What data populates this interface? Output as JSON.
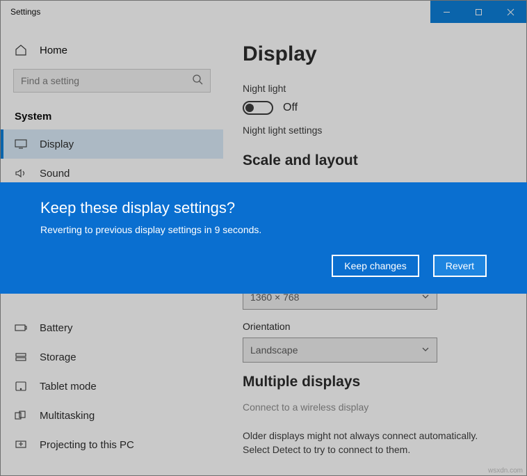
{
  "window": {
    "title": "Settings"
  },
  "home": {
    "label": "Home"
  },
  "search": {
    "placeholder": "Find a setting"
  },
  "group": {
    "title": "System"
  },
  "nav": {
    "items": [
      {
        "label": "Display",
        "selected": true
      },
      {
        "label": "Sound",
        "selected": false
      },
      {
        "label": "Battery",
        "selected": false
      },
      {
        "label": "Storage",
        "selected": false
      },
      {
        "label": "Tablet mode",
        "selected": false
      },
      {
        "label": "Multitasking",
        "selected": false
      },
      {
        "label": "Projecting to this PC",
        "selected": false
      }
    ]
  },
  "content": {
    "title": "Display",
    "night_light_label": "Night light",
    "night_light_state": "Off",
    "night_light_link": "Night light settings",
    "scale_heading": "Scale and layout",
    "resolution_value": "1360 × 768",
    "orientation_label": "Orientation",
    "orientation_value": "Landscape",
    "multi_heading": "Multiple displays",
    "wireless_link": "Connect to a wireless display",
    "older_text": "Older displays might not always connect automatically. Select Detect to try to connect to them."
  },
  "dialog": {
    "title": "Keep these display settings?",
    "body_prefix": "Reverting to previous display settings in ",
    "seconds": "9",
    "body_suffix": " seconds.",
    "keep": "Keep changes",
    "revert": "Revert"
  },
  "watermark": "wsxdn.com"
}
